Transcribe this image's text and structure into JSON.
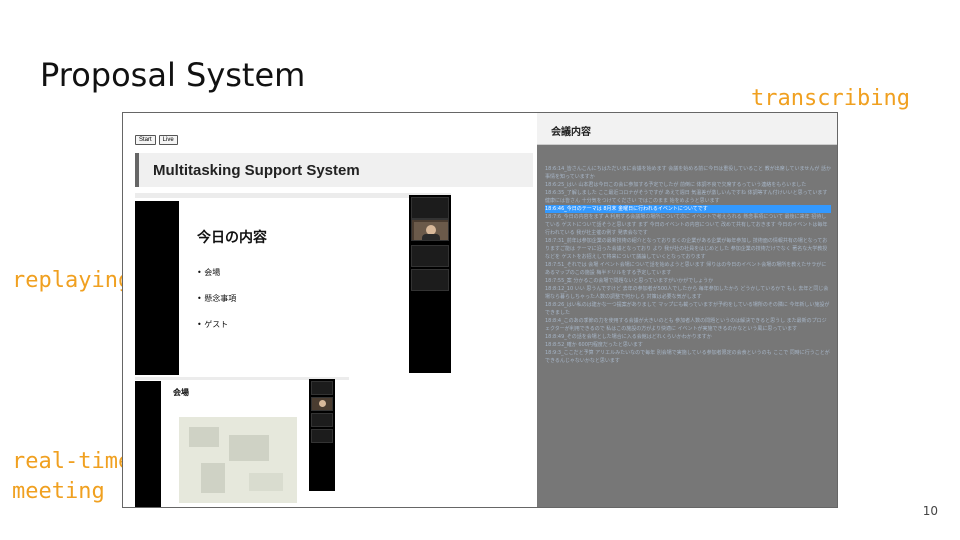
{
  "slide": {
    "title": "Proposal System",
    "page_number": "10",
    "labels": {
      "transcribing": "transcribing",
      "replaying": "replaying",
      "realtime_line1": "real-time",
      "realtime_line2": "meeting"
    }
  },
  "app": {
    "buttons": {
      "start": "Start",
      "live": "Live"
    },
    "header_title": "Multitasking Support System",
    "replay": {
      "heading": "今日の内容",
      "bullets": [
        "• 会場",
        "• 懸念事項",
        "• ゲスト"
      ]
    },
    "realtime": {
      "heading": "会場"
    },
    "transcript": {
      "title": "会議内容",
      "lines": [
        "18:6:14_皆さんこんにちはただいまに会議を始めます 会議を始める前に今日は重役していること 教が出席していませんが 話か 事情を知っていますか",
        "18:6:25_はい 山本君は今日この会に参加する予定でしたが 前倒に 体調不良で欠席するっていう連絡をもらいました",
        "18:6:35_了解しました ここ最近コロナがそうですが あえて週日 気温差が激しいんですね 体調等すん付けいいと思っています 健康には皆さん 十分気をつけてください ではこのまま 始をめようと思います",
        "18:6:46_今日のテーマは 8月末 金曜日に行われるイベントについてです",
        "18:7:6_今日の内容をまず A 利用する会議場の場所について次に イベントで考えられる 懸念事項について 最後に来年 招待している ゲストについて話そうと思います まず 今日のイベントの内容について 改めて共有しておきます 今日のイベントは毎年行われている 我が社主催の例す 発表会なです",
        "18:7:31_前年は参加企業の最新技術の紹介となっておりまくの企業がある企業が毎年参加し 技術面の情報共有の場となっておりますご能は テーマに沿った会議となっており より 我が社の社員をはじめとした 参加企業の技術だけでなく 著名な大学教授などを ゲストをお招えして将来について議論していくとなっております",
        "18:7:51_それでは 会場 イベント会場について話を始めようと思います 帰りはの今日のイベント会場の場所を教えたサラがにあるマップのこの施設 梅半ドリルをする予定しています",
        "18:7:55_案 分かるこの会場で問題ないと思っていますがいかがでしょうか",
        "18:8:12_10 いい 思うんですけど 去年の参加者が500人でしたから 毎年参加したから どうかしているかで もし 去年と同じ会場なら暮らしちゃった人数の調整で何かしら 対策は必要な気がします",
        "18:8:26_はい私のは建かな一つ提案がありまして マップにも載っていますが予約をしている場所のその隣に 今年新しい施設ができました",
        "18:8:4_このあの季節の力を使用する会議が大きいのとも 参加者人数の問題というのは解決できると思うし また最新のプロジェクターが利用できるので 私はこの施設の方がより快適に イベントが実施できるのかなという風に思っています",
        "18:8:49_その話を会場とした場合に入る会館はどれくらいかわかりますか",
        "18:8:52_確か 600円程度だったと思います",
        "18:9:3_ここだと予算 アリエルみたいなので毎年 別会場で実施している参加者限定の会食というのも ここで 同時に行うことができるんじゃないかなと思います"
      ],
      "highlight_index": 3
    }
  }
}
